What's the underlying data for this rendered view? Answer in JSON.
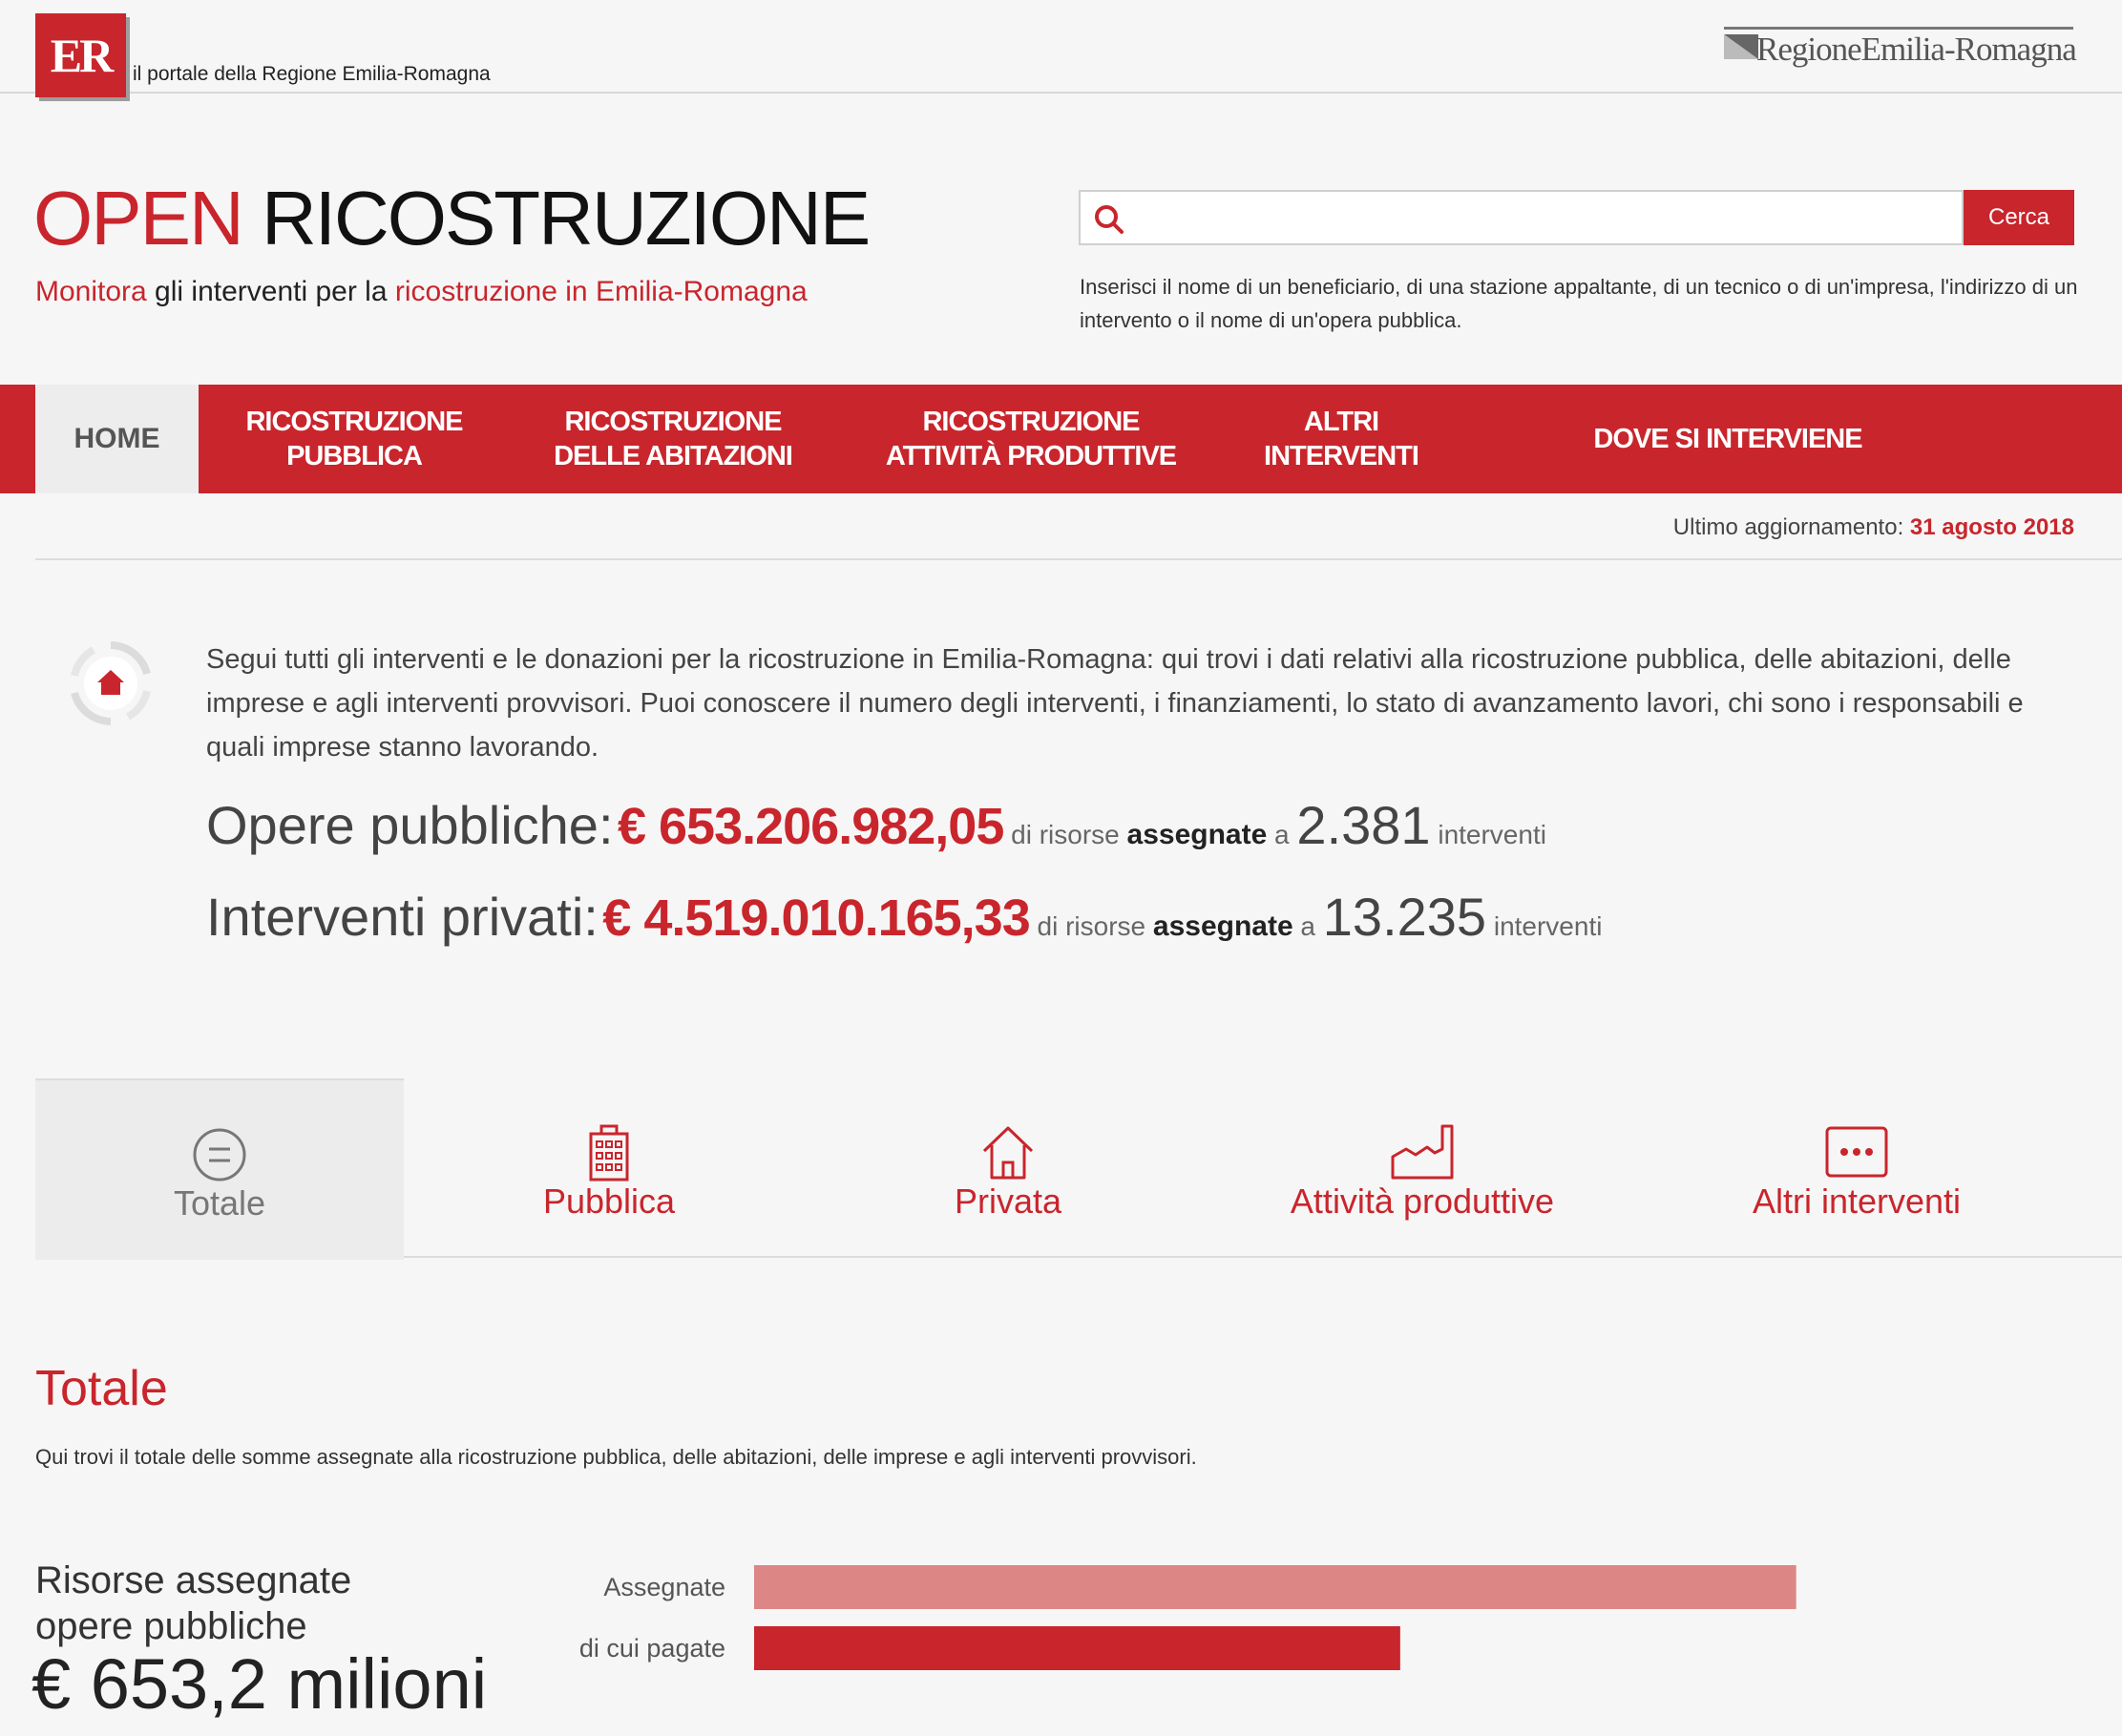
{
  "header": {
    "logo_text": "ER",
    "portal_text": "il portale della Regione Emilia-Romagna",
    "region_name": "RegioneEmilia-Romagna"
  },
  "title": {
    "open": "OPEN",
    "rest": " RICOSTRUZIONE",
    "subtitle_parts": [
      "Monitora",
      " gli interventi  per la ",
      "ricostruzione in Emilia-Romagna"
    ]
  },
  "search": {
    "value": "",
    "placeholder": "",
    "button_label": "Cerca",
    "hint": "Inserisci il nome di un beneficiario, di una stazione appaltante, di un tecnico o di un'impresa, l'indirizzo di un intervento o il nome di un'opera pubblica."
  },
  "nav": {
    "home": "HOME",
    "items": [
      {
        "line1": "RICOSTRUZIONE",
        "line2": "PUBBLICA"
      },
      {
        "line1": "RICOSTRUZIONE",
        "line2": "DELLE ABITAZIONI"
      },
      {
        "line1": "RICOSTRUZIONE",
        "line2": "ATTIVITÀ PRODUTTIVE"
      },
      {
        "line1": "ALTRI INTERVENTI",
        "line2": ""
      },
      {
        "line1": "DOVE SI INTERVIENE",
        "line2": ""
      }
    ]
  },
  "update": {
    "label": "Ultimo aggiornamento: ",
    "date": "31 agosto 2018"
  },
  "intro": {
    "text": "Segui tutti gli interventi e le donazioni per la ricostruzione in Emilia-Romagna: qui trovi i dati relativi alla ricostruzione pubblica, delle abitazioni, delle imprese e agli interventi provvisori. Puoi conoscere il numero degli interventi, i finanziamenti, lo stato di avanzamento lavori, chi sono i responsabili e quali imprese stanno lavorando."
  },
  "stats": {
    "pubbliche": {
      "label": "Opere pubbliche:",
      "amount": "€ 653.206.982,05",
      "mid1": " di risorse ",
      "strong": "assegnate",
      "mid2": " a ",
      "count": "2.381",
      "unit": " interventi"
    },
    "privati": {
      "label": "Interventi privati:",
      "amount": "€ 4.519.010.165,33",
      "mid1": " di risorse ",
      "strong": "assegnate",
      "mid2": " a ",
      "count": "13.235",
      "unit": " interventi"
    }
  },
  "tabs": [
    {
      "label": "Totale",
      "icon": "equals-circle-icon"
    },
    {
      "label": "Pubblica",
      "icon": "building-icon"
    },
    {
      "label": "Privata",
      "icon": "house-icon"
    },
    {
      "label": "Attività produttive",
      "icon": "factory-icon"
    },
    {
      "label": "Altri interventi",
      "icon": "dots-box-icon"
    }
  ],
  "section": {
    "title": "Totale",
    "description": "Qui trovi il totale delle somme assegnate alla ricostruzione pubblica, delle abitazioni, delle imprese e agli interventi provvisori.",
    "resource_label_line1": "Risorse assegnate",
    "resource_label_line2": "opere pubbliche",
    "resource_total": "€ 653,2 milioni"
  },
  "colors": {
    "brand_red": "#c9252c",
    "light_red": "#dd8686"
  },
  "chart_data": {
    "type": "bar",
    "orientation": "horizontal",
    "categories": [
      "Assegnate",
      "di cui pagate"
    ],
    "values": [
      653.2,
      405
    ],
    "unit": "milioni €",
    "xlim": [
      0,
      730
    ],
    "colors": [
      "#dd8686",
      "#c9252c"
    ]
  }
}
